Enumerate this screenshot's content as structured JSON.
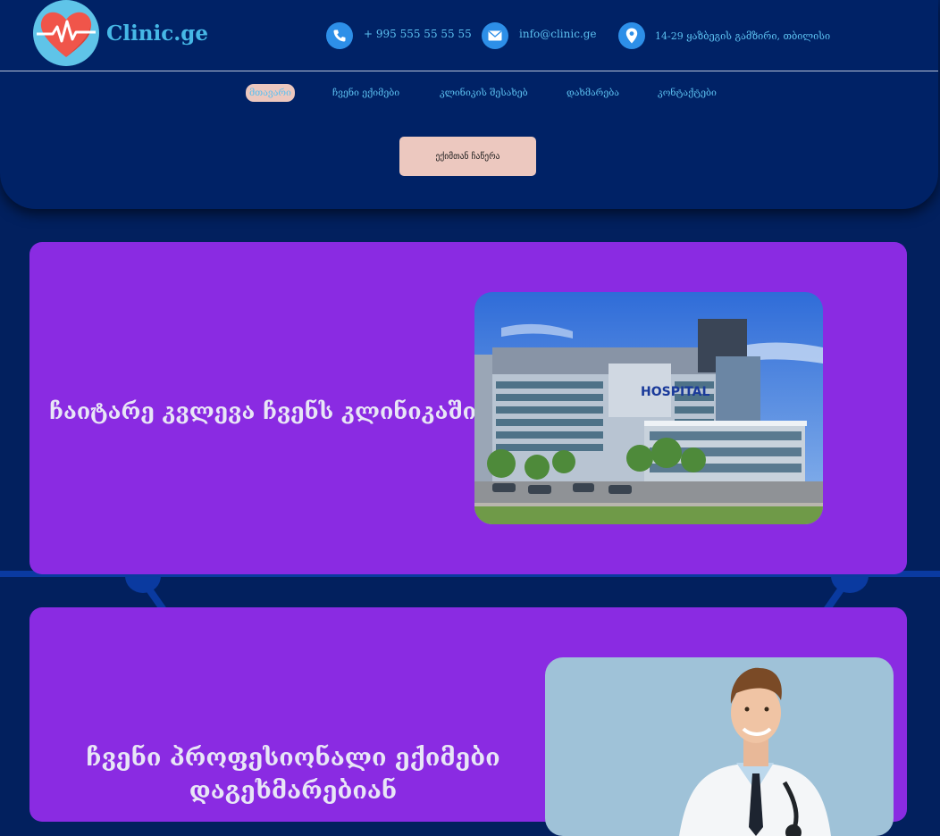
{
  "brand": {
    "name": "Clinic.ge",
    "logo_icon": "heart-pulse-icon"
  },
  "contacts": [
    {
      "icon": "phone-icon",
      "text": "+ 995 555 55 55 55"
    },
    {
      "icon": "mail-icon",
      "text": "info@clinic.ge"
    },
    {
      "icon": "location-pin-icon",
      "text": "14-29 ყაზბეგის გამზირი, თბილისი"
    }
  ],
  "nav": {
    "items": [
      {
        "label": "მთავარი",
        "active": true
      },
      {
        "label": "ჩვენი ექიმები"
      },
      {
        "label": "კლინიკის შესახებ"
      },
      {
        "label": "დახმარება"
      },
      {
        "label": "კონტაქტები"
      }
    ]
  },
  "cta": {
    "label": "ექიმთან ჩაწერა"
  },
  "sections": [
    {
      "title": "ჩაიტარე კვლევა ჩვენს კლინიკაში",
      "image": "hospital-building-photo",
      "sign_text": "HOSPITAL"
    },
    {
      "title": "ჩვენი პროფესიონალი ექიმები დაგეხმარებიან",
      "image": "smiling-doctor-photo"
    }
  ],
  "colors": {
    "background": "#02205e",
    "header": "#002266",
    "accent_text": "#5cc0f0",
    "card": "#8a2be2",
    "button": "#ecc8bf"
  }
}
